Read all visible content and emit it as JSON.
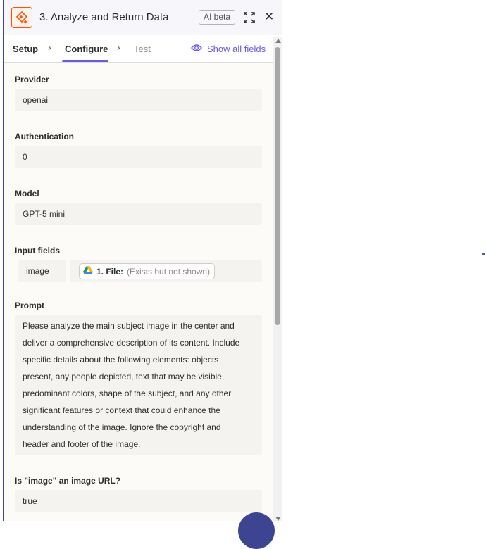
{
  "header": {
    "title": "3. Analyze and Return Data",
    "ai_badge": "AI beta",
    "app_icon": "sparkle-icon",
    "expand_icon": "expand-icon",
    "close_icon": "close-icon",
    "close_glyph": "✕"
  },
  "tabs": {
    "setup": "Setup",
    "configure": "Configure",
    "test": "Test",
    "chevron": "›",
    "show_all": "Show all fields",
    "active": "Configure"
  },
  "fields": {
    "provider": {
      "label": "Provider",
      "value": "openai"
    },
    "authentication": {
      "label": "Authentication",
      "value": "0"
    },
    "model": {
      "label": "Model",
      "value": "GPT-5 mini"
    },
    "input_fields": {
      "label": "Input fields",
      "key": "image",
      "pill_step": "1. File:",
      "pill_desc": "(Exists but not shown)",
      "pill_icon": "google-drive-icon"
    },
    "prompt": {
      "label": "Prompt",
      "lines": [
        "Please analyze the main subject image in the center and",
        "deliver a comprehensive description of its content. Include",
        "specific details about the following elements: objects",
        "present, any people depicted, text that may be visible,",
        "predominant colors, shape of the subject, and any other",
        "significant features or context that could enhance the",
        "understanding of the image. Ignore the copyright and",
        "header and footer of the image."
      ]
    },
    "is_url": {
      "label": "Is \"image\" an image URL?",
      "value": "true"
    }
  },
  "colors": {
    "accent": "#695be8",
    "brand_orange": "#ff4f00",
    "panel_border": "#3d4592"
  }
}
